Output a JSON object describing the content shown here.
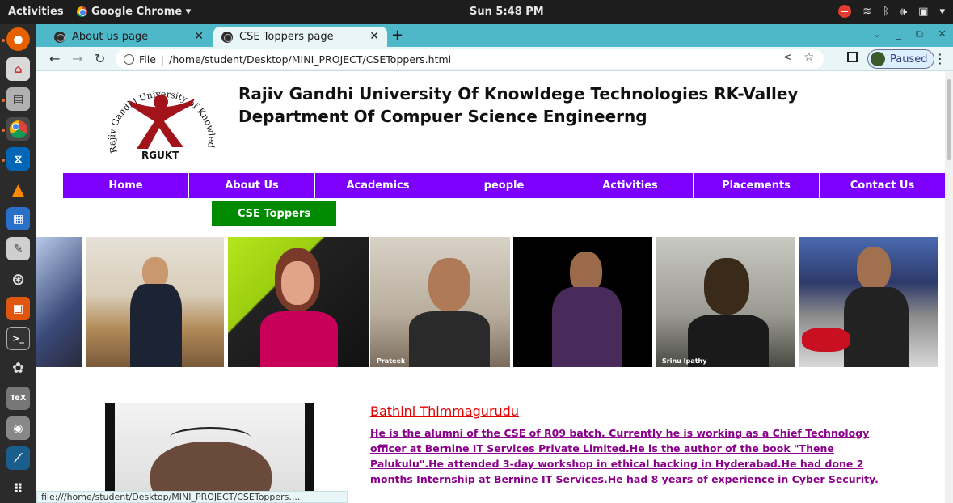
{
  "topbar": {
    "activities": "Activities",
    "app_name": "Google Chrome ▾",
    "clock": "Sun  5:48 PM",
    "tray": [
      "wifi-icon",
      "bluetooth-icon",
      "volume-icon",
      "battery-icon",
      "menu-icon"
    ]
  },
  "browser": {
    "tabs": [
      {
        "label": "About us page",
        "active": false
      },
      {
        "label": "CSE Toppers page",
        "active": true
      }
    ],
    "new_tab": "+",
    "address": {
      "scheme": "File",
      "path": "/home/student/Desktop/MINI_PROJECT/CSEToppers.html"
    },
    "profile_status": "Paused",
    "status_bar": "file:///home/student/Desktop/MINI_PROJECT/CSEToppers...."
  },
  "page": {
    "logo_text": "RGUKT",
    "logo_ring_text": "Rajiv Gandhi University of Knowledge Technologies",
    "title_line1": "Rajiv Gandhi University Of Knowldege Technologies RK-Valley",
    "title_line2": "Department Of Compuer Science Engineerng",
    "menu": [
      "Home",
      "About Us",
      "Academics",
      "people",
      "Activities",
      "Placements",
      "Contact Us"
    ],
    "submenu": "CSE Toppers",
    "photo_captions": [
      "Prateek",
      "Srinu Ipathy"
    ],
    "profile": {
      "name": "Bathini Thimmagurudu",
      "bio": "He is the alumni of the CSE of R09 batch. Currently he is working as a Chief Technology officer at Bernine IT Services Private Limited.He is the author of the book \"Thene Palukulu\".He attended 3-day workshop in ethical hacking in Hyderabad.He had done 2 months Internship at Bernine IT Services.He had 8 years of experience in Cyber Security."
    }
  },
  "colors": {
    "menu_bg": "#7d00ff",
    "submenu_bg": "#008a00",
    "tab_strip": "#4fb8c8",
    "name_red": "#e00000",
    "bio_purple": "#8b008b"
  }
}
